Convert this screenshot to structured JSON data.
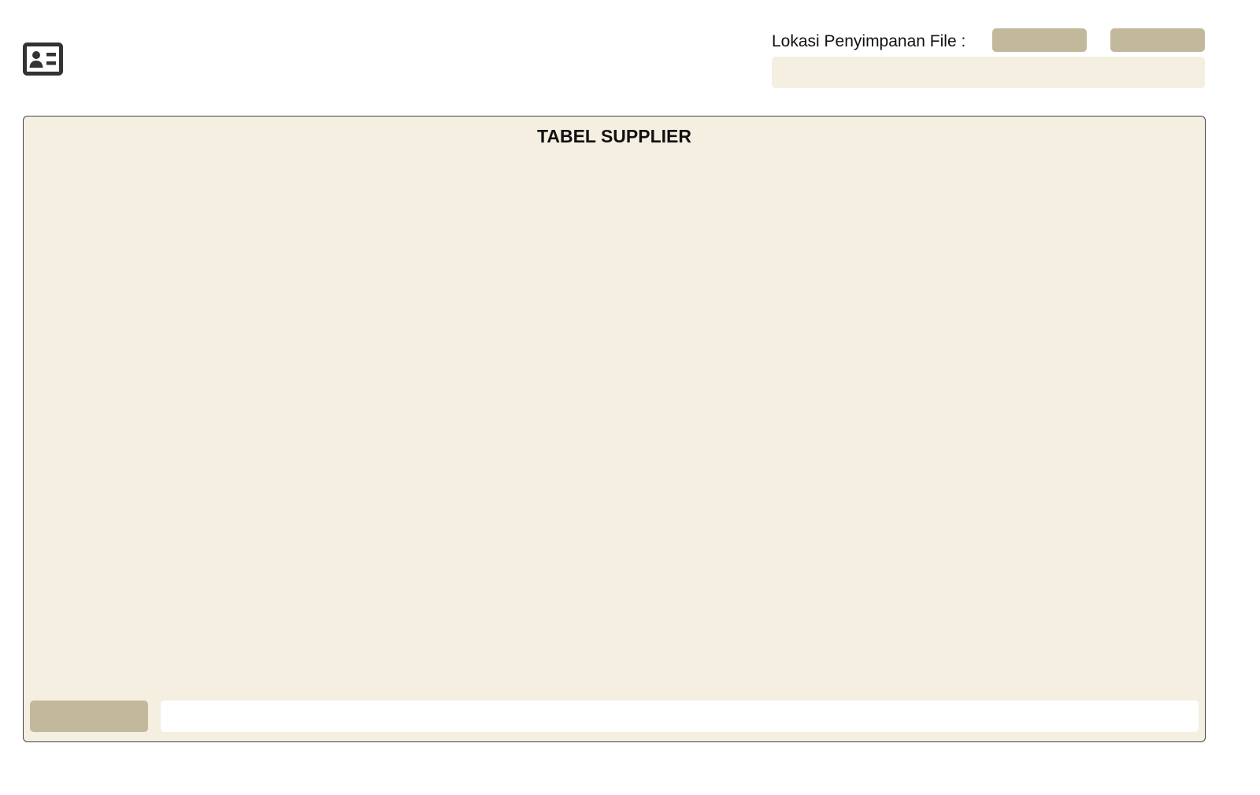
{
  "header": {
    "app_icon": "contact-card-icon",
    "storage_label": "Lokasi Penyimpanan File :",
    "browse_button_label": "",
    "save_button_label": "",
    "storage_path_value": "",
    "storage_path_placeholder": ""
  },
  "table": {
    "title": "TABEL SUPPLIER",
    "columns": [],
    "rows": [],
    "search_button_label": "",
    "search_value": "",
    "search_placeholder": ""
  },
  "colors": {
    "panel_background": "#f4efe1",
    "button_background": "#c2b89b",
    "panel_border": "#444444",
    "icon": "#333333"
  }
}
